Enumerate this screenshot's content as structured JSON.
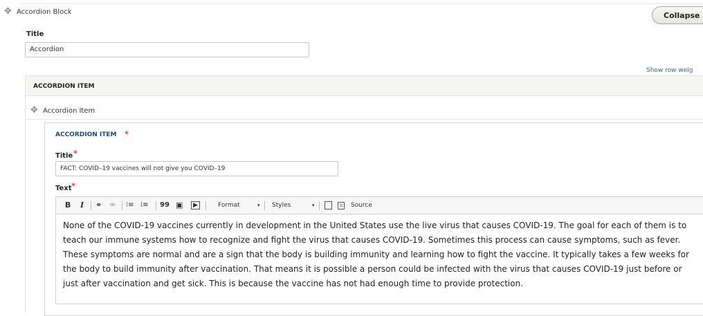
{
  "block": {
    "label": "Accordion Block",
    "collapse_label": "Collapse"
  },
  "title_field": {
    "label": "Title",
    "value": "Accordion"
  },
  "show_row_weights": "Show row weig",
  "accordion_item_header": "ACCORDION ITEM",
  "accordion_item_row_label": "Accordion Item",
  "inner": {
    "header": "ACCORDION ITEM",
    "required_mark": "*",
    "title_label": "Title",
    "title_value": "FACT: COVID–19 vaccines will not give you COVID–19",
    "text_label": "Text"
  },
  "toolbar": {
    "bold": "B",
    "italic": "I",
    "link": "⚭",
    "unlink": "⚮",
    "bullets": "⁝≡",
    "numbers": "⁞≡",
    "quote": "99",
    "image": "▣",
    "media": "▶",
    "format": "Format",
    "styles": "Styles",
    "source_label": "Source"
  },
  "editor_text": "None of the COVID-19 vaccines currently in development in the United States use the live virus that causes COVID-19. The goal for each of them is to teach our immune systems how to recognize and fight the virus that causes COVID-19. Sometimes this process can cause symptoms, such as fever. These symptoms are normal and are a sign that the body is building immunity and learning how to fight the vaccine. It typically takes a few weeks for the body to build immunity after vaccination. That means it is possible a person could be infected with the virus that causes COVID-19 just before or just after vaccination and get sick. This is because the vaccine has not had enough time to provide protection."
}
